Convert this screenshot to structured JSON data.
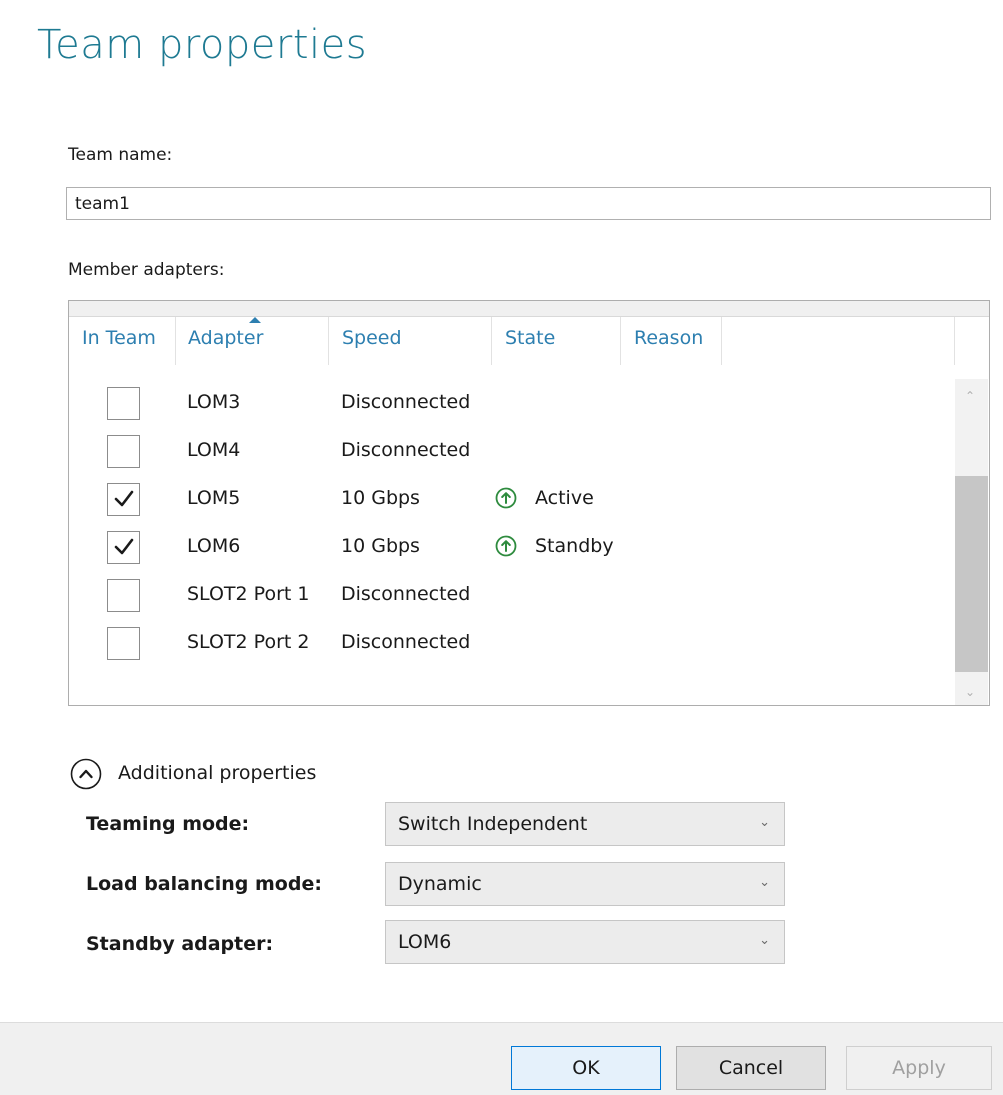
{
  "dialog": {
    "title": "Team properties"
  },
  "team_name": {
    "label": "Team name:",
    "value": "team1"
  },
  "member_adapters": {
    "label": "Member adapters:",
    "columns": [
      "In Team",
      "Adapter",
      "Speed",
      "State",
      "Reason"
    ],
    "sorted_column": "Adapter",
    "rows": [
      {
        "in_team": false,
        "adapter": "LOM3",
        "speed": "Disconnected",
        "state": "",
        "reason": ""
      },
      {
        "in_team": false,
        "adapter": "LOM4",
        "speed": "Disconnected",
        "state": "",
        "reason": ""
      },
      {
        "in_team": true,
        "adapter": "LOM5",
        "speed": "10 Gbps",
        "state": "Active",
        "reason": ""
      },
      {
        "in_team": true,
        "adapter": "LOM6",
        "speed": "10 Gbps",
        "state": "Standby",
        "reason": ""
      },
      {
        "in_team": false,
        "adapter": "SLOT2 Port 1",
        "speed": "Disconnected",
        "state": "",
        "reason": ""
      },
      {
        "in_team": false,
        "adapter": "SLOT2 Port 2",
        "speed": "Disconnected",
        "state": "",
        "reason": ""
      }
    ]
  },
  "additional_properties": {
    "toggle_label": "Additional properties",
    "expanded": true,
    "teaming_mode": {
      "label": "Teaming mode:",
      "value": "Switch Independent"
    },
    "load_balancing_mode": {
      "label": "Load balancing mode:",
      "value": "Dynamic"
    },
    "standby_adapter": {
      "label": "Standby adapter:",
      "value": "LOM6"
    }
  },
  "buttons": {
    "ok": "OK",
    "cancel": "Cancel",
    "apply": "Apply"
  },
  "icons": {
    "state_up": "arrow-up-circle-icon",
    "checkbox_check": "checkmark-icon",
    "expand_toggle": "chevron-up-circle-icon",
    "dropdown": "chevron-down-icon"
  },
  "colors": {
    "title": "#1e7a92",
    "column_header": "#2d7fb0",
    "state_up_green": "#2e8b3e",
    "ok_border": "#0078d7"
  }
}
